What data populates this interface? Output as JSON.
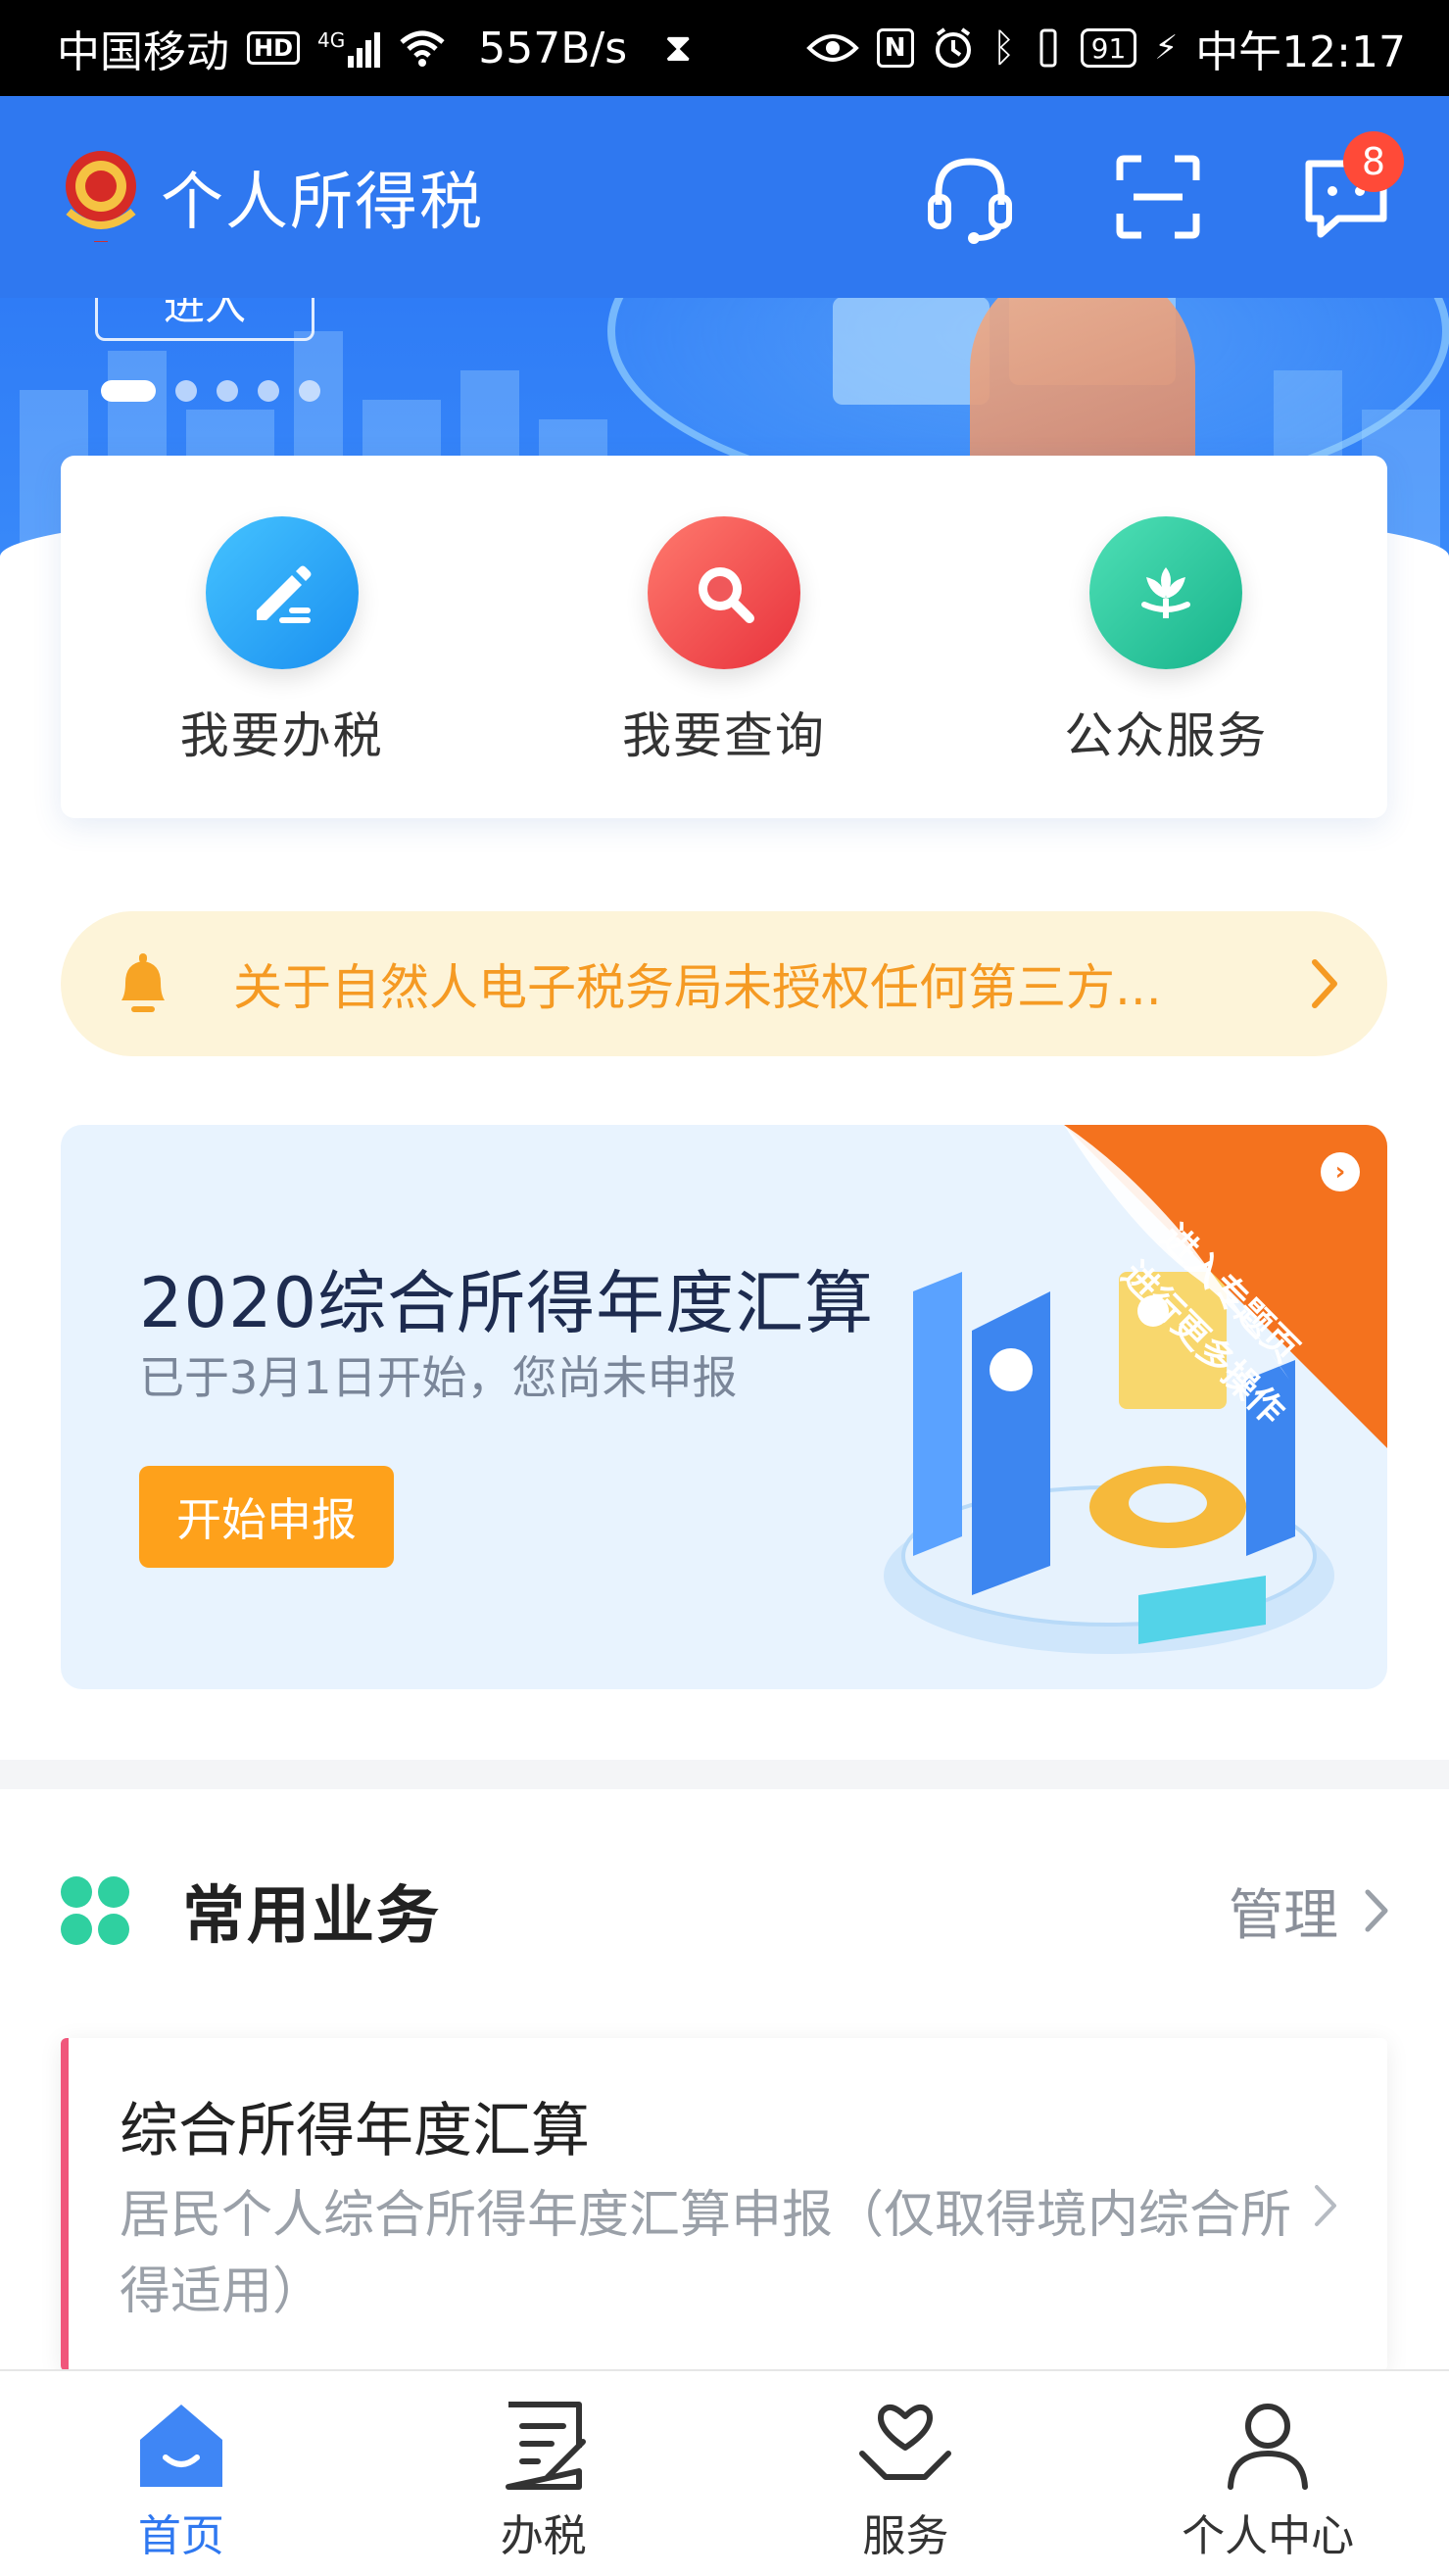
{
  "status_bar": {
    "carrier": "中国移动",
    "hd": "HD",
    "network": "4G",
    "speed": "557B/s",
    "battery": "91",
    "time": "中午12:17"
  },
  "header": {
    "title": "个人所得税",
    "badge_count": "8"
  },
  "banner": {
    "enter_label": "进入",
    "dots_total": 5,
    "active_dot": 1
  },
  "quick_actions": [
    {
      "label": "我要办税",
      "icon": "edit-icon",
      "color": "#28a9f5"
    },
    {
      "label": "我要查询",
      "icon": "search-icon",
      "color": "#f0585a"
    },
    {
      "label": "公众服务",
      "icon": "flower-icon",
      "color": "#27c9a0"
    }
  ],
  "notice": {
    "text": "关于自然人电子税务局未授权任何第三方..."
  },
  "promo": {
    "title": "2020综合所得年度汇算",
    "subtitle": "已于3月1日开始，您尚未申报",
    "button": "开始申报",
    "corner_text_1": "进入专题页",
    "corner_text_2": "进行更多操作"
  },
  "common": {
    "title": "常用业务",
    "manage": "管理",
    "items": [
      {
        "title": "综合所得年度汇算",
        "desc": "居民个人综合所得年度汇算申报（仅取得境内综合所得适用）"
      }
    ]
  },
  "bottom_nav": [
    {
      "label": "首页",
      "icon": "home-icon",
      "active": true
    },
    {
      "label": "办税",
      "icon": "document-edit-icon",
      "active": false
    },
    {
      "label": "服务",
      "icon": "heart-hand-icon",
      "active": false
    },
    {
      "label": "个人中心",
      "icon": "person-icon",
      "active": false
    }
  ],
  "colors": {
    "brand_blue": "#2f78f0",
    "accent_orange": "#fea11b",
    "notice_text": "#f59a23"
  }
}
